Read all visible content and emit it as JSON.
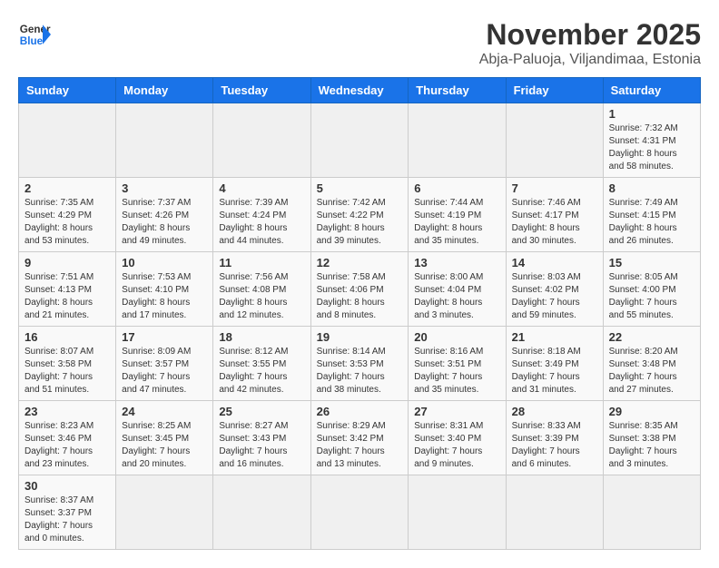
{
  "header": {
    "logo_general": "General",
    "logo_blue": "Blue",
    "month_title": "November 2025",
    "subtitle": "Abja-Paluoja, Viljandimaa, Estonia"
  },
  "weekdays": [
    "Sunday",
    "Monday",
    "Tuesday",
    "Wednesday",
    "Thursday",
    "Friday",
    "Saturday"
  ],
  "weeks": [
    [
      {
        "day": "",
        "info": ""
      },
      {
        "day": "",
        "info": ""
      },
      {
        "day": "",
        "info": ""
      },
      {
        "day": "",
        "info": ""
      },
      {
        "day": "",
        "info": ""
      },
      {
        "day": "",
        "info": ""
      },
      {
        "day": "1",
        "info": "Sunrise: 7:32 AM\nSunset: 4:31 PM\nDaylight: 8 hours\nand 58 minutes."
      }
    ],
    [
      {
        "day": "2",
        "info": "Sunrise: 7:35 AM\nSunset: 4:29 PM\nDaylight: 8 hours\nand 53 minutes."
      },
      {
        "day": "3",
        "info": "Sunrise: 7:37 AM\nSunset: 4:26 PM\nDaylight: 8 hours\nand 49 minutes."
      },
      {
        "day": "4",
        "info": "Sunrise: 7:39 AM\nSunset: 4:24 PM\nDaylight: 8 hours\nand 44 minutes."
      },
      {
        "day": "5",
        "info": "Sunrise: 7:42 AM\nSunset: 4:22 PM\nDaylight: 8 hours\nand 39 minutes."
      },
      {
        "day": "6",
        "info": "Sunrise: 7:44 AM\nSunset: 4:19 PM\nDaylight: 8 hours\nand 35 minutes."
      },
      {
        "day": "7",
        "info": "Sunrise: 7:46 AM\nSunset: 4:17 PM\nDaylight: 8 hours\nand 30 minutes."
      },
      {
        "day": "8",
        "info": "Sunrise: 7:49 AM\nSunset: 4:15 PM\nDaylight: 8 hours\nand 26 minutes."
      }
    ],
    [
      {
        "day": "9",
        "info": "Sunrise: 7:51 AM\nSunset: 4:13 PM\nDaylight: 8 hours\nand 21 minutes."
      },
      {
        "day": "10",
        "info": "Sunrise: 7:53 AM\nSunset: 4:10 PM\nDaylight: 8 hours\nand 17 minutes."
      },
      {
        "day": "11",
        "info": "Sunrise: 7:56 AM\nSunset: 4:08 PM\nDaylight: 8 hours\nand 12 minutes."
      },
      {
        "day": "12",
        "info": "Sunrise: 7:58 AM\nSunset: 4:06 PM\nDaylight: 8 hours\nand 8 minutes."
      },
      {
        "day": "13",
        "info": "Sunrise: 8:00 AM\nSunset: 4:04 PM\nDaylight: 8 hours\nand 3 minutes."
      },
      {
        "day": "14",
        "info": "Sunrise: 8:03 AM\nSunset: 4:02 PM\nDaylight: 7 hours\nand 59 minutes."
      },
      {
        "day": "15",
        "info": "Sunrise: 8:05 AM\nSunset: 4:00 PM\nDaylight: 7 hours\nand 55 minutes."
      }
    ],
    [
      {
        "day": "16",
        "info": "Sunrise: 8:07 AM\nSunset: 3:58 PM\nDaylight: 7 hours\nand 51 minutes."
      },
      {
        "day": "17",
        "info": "Sunrise: 8:09 AM\nSunset: 3:57 PM\nDaylight: 7 hours\nand 47 minutes."
      },
      {
        "day": "18",
        "info": "Sunrise: 8:12 AM\nSunset: 3:55 PM\nDaylight: 7 hours\nand 42 minutes."
      },
      {
        "day": "19",
        "info": "Sunrise: 8:14 AM\nSunset: 3:53 PM\nDaylight: 7 hours\nand 38 minutes."
      },
      {
        "day": "20",
        "info": "Sunrise: 8:16 AM\nSunset: 3:51 PM\nDaylight: 7 hours\nand 35 minutes."
      },
      {
        "day": "21",
        "info": "Sunrise: 8:18 AM\nSunset: 3:49 PM\nDaylight: 7 hours\nand 31 minutes."
      },
      {
        "day": "22",
        "info": "Sunrise: 8:20 AM\nSunset: 3:48 PM\nDaylight: 7 hours\nand 27 minutes."
      }
    ],
    [
      {
        "day": "23",
        "info": "Sunrise: 8:23 AM\nSunset: 3:46 PM\nDaylight: 7 hours\nand 23 minutes."
      },
      {
        "day": "24",
        "info": "Sunrise: 8:25 AM\nSunset: 3:45 PM\nDaylight: 7 hours\nand 20 minutes."
      },
      {
        "day": "25",
        "info": "Sunrise: 8:27 AM\nSunset: 3:43 PM\nDaylight: 7 hours\nand 16 minutes."
      },
      {
        "day": "26",
        "info": "Sunrise: 8:29 AM\nSunset: 3:42 PM\nDaylight: 7 hours\nand 13 minutes."
      },
      {
        "day": "27",
        "info": "Sunrise: 8:31 AM\nSunset: 3:40 PM\nDaylight: 7 hours\nand 9 minutes."
      },
      {
        "day": "28",
        "info": "Sunrise: 8:33 AM\nSunset: 3:39 PM\nDaylight: 7 hours\nand 6 minutes."
      },
      {
        "day": "29",
        "info": "Sunrise: 8:35 AM\nSunset: 3:38 PM\nDaylight: 7 hours\nand 3 minutes."
      }
    ],
    [
      {
        "day": "30",
        "info": "Sunrise: 8:37 AM\nSunset: 3:37 PM\nDaylight: 7 hours\nand 0 minutes."
      },
      {
        "day": "",
        "info": ""
      },
      {
        "day": "",
        "info": ""
      },
      {
        "day": "",
        "info": ""
      },
      {
        "day": "",
        "info": ""
      },
      {
        "day": "",
        "info": ""
      },
      {
        "day": "",
        "info": ""
      }
    ]
  ]
}
